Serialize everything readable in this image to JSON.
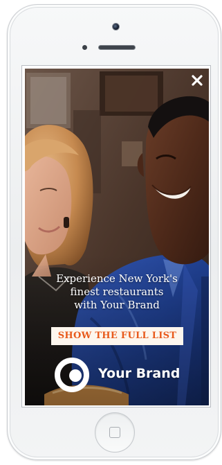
{
  "ad": {
    "headline_lines": [
      "Experience New York's",
      "finest restaurants",
      "with Your Brand"
    ],
    "cta_label": "SHOW THE FULL LIST",
    "brand_name": "Your Brand",
    "close_icon": "close-icon"
  },
  "device": {
    "type": "smartphone",
    "color": "white"
  },
  "colors": {
    "cta_text": "#e85a1c",
    "cta_background": "#fdf6ee",
    "shirt_blue": "#1f3f8f",
    "overlay_text": "#ffffff"
  }
}
